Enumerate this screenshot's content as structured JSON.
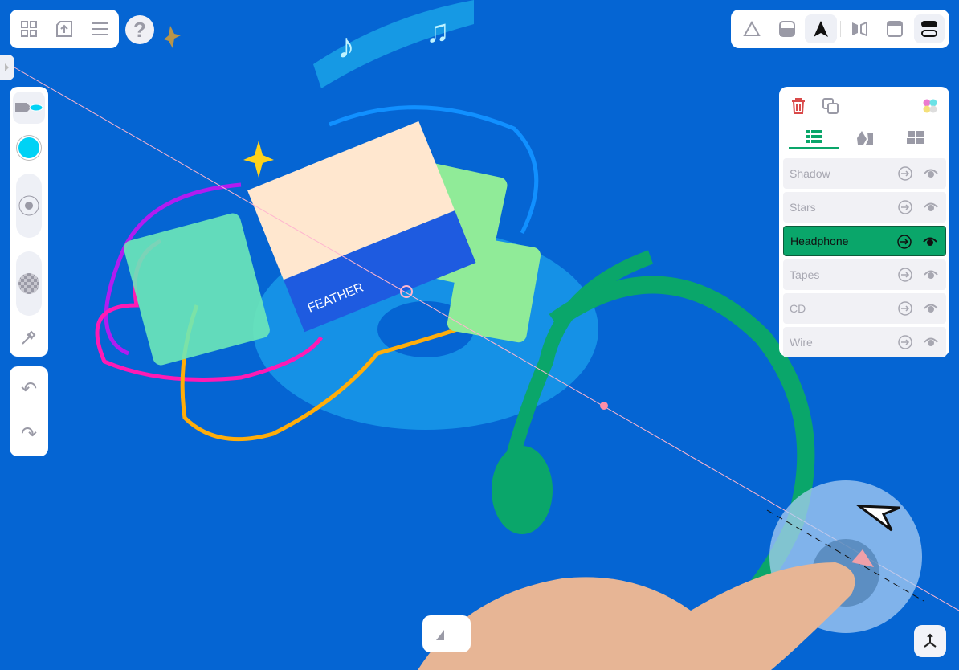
{
  "top_left_toolbar": {
    "icons": [
      "grid-icon",
      "upload-icon",
      "menu-icon"
    ],
    "help_label": "?"
  },
  "view_toolbar": {
    "icons": [
      "perspective-icon",
      "ground-icon",
      "navigate-icon",
      "mirror-icon",
      "window-icon",
      "layout-icon"
    ],
    "active": "navigate-icon"
  },
  "left_tools": {
    "brush_color": "#00d2f5",
    "icons": [
      "brush-icon",
      "color-swatch",
      "size-icon",
      "opacity-icon",
      "eyedropper-icon",
      "undo-icon",
      "redo-icon"
    ]
  },
  "layers_panel": {
    "icons": [
      "trash-icon",
      "duplicate-icon",
      "palette-icon"
    ],
    "tabs": [
      "layers-tab",
      "shapes-tab",
      "groups-tab"
    ],
    "active_tab": "layers-tab",
    "layers": [
      {
        "name": "Shadow",
        "selected": false
      },
      {
        "name": "Stars",
        "selected": false
      },
      {
        "name": "Headphone",
        "selected": true
      },
      {
        "name": "Tapes",
        "selected": false
      },
      {
        "name": "CD",
        "selected": false
      },
      {
        "name": "Wire",
        "selected": false
      }
    ]
  },
  "canvas": {
    "cassette_label": "FEATHER"
  },
  "colors": {
    "background": "#0565d3",
    "accent": "#0aa66a",
    "delete": "#d94a4a"
  }
}
